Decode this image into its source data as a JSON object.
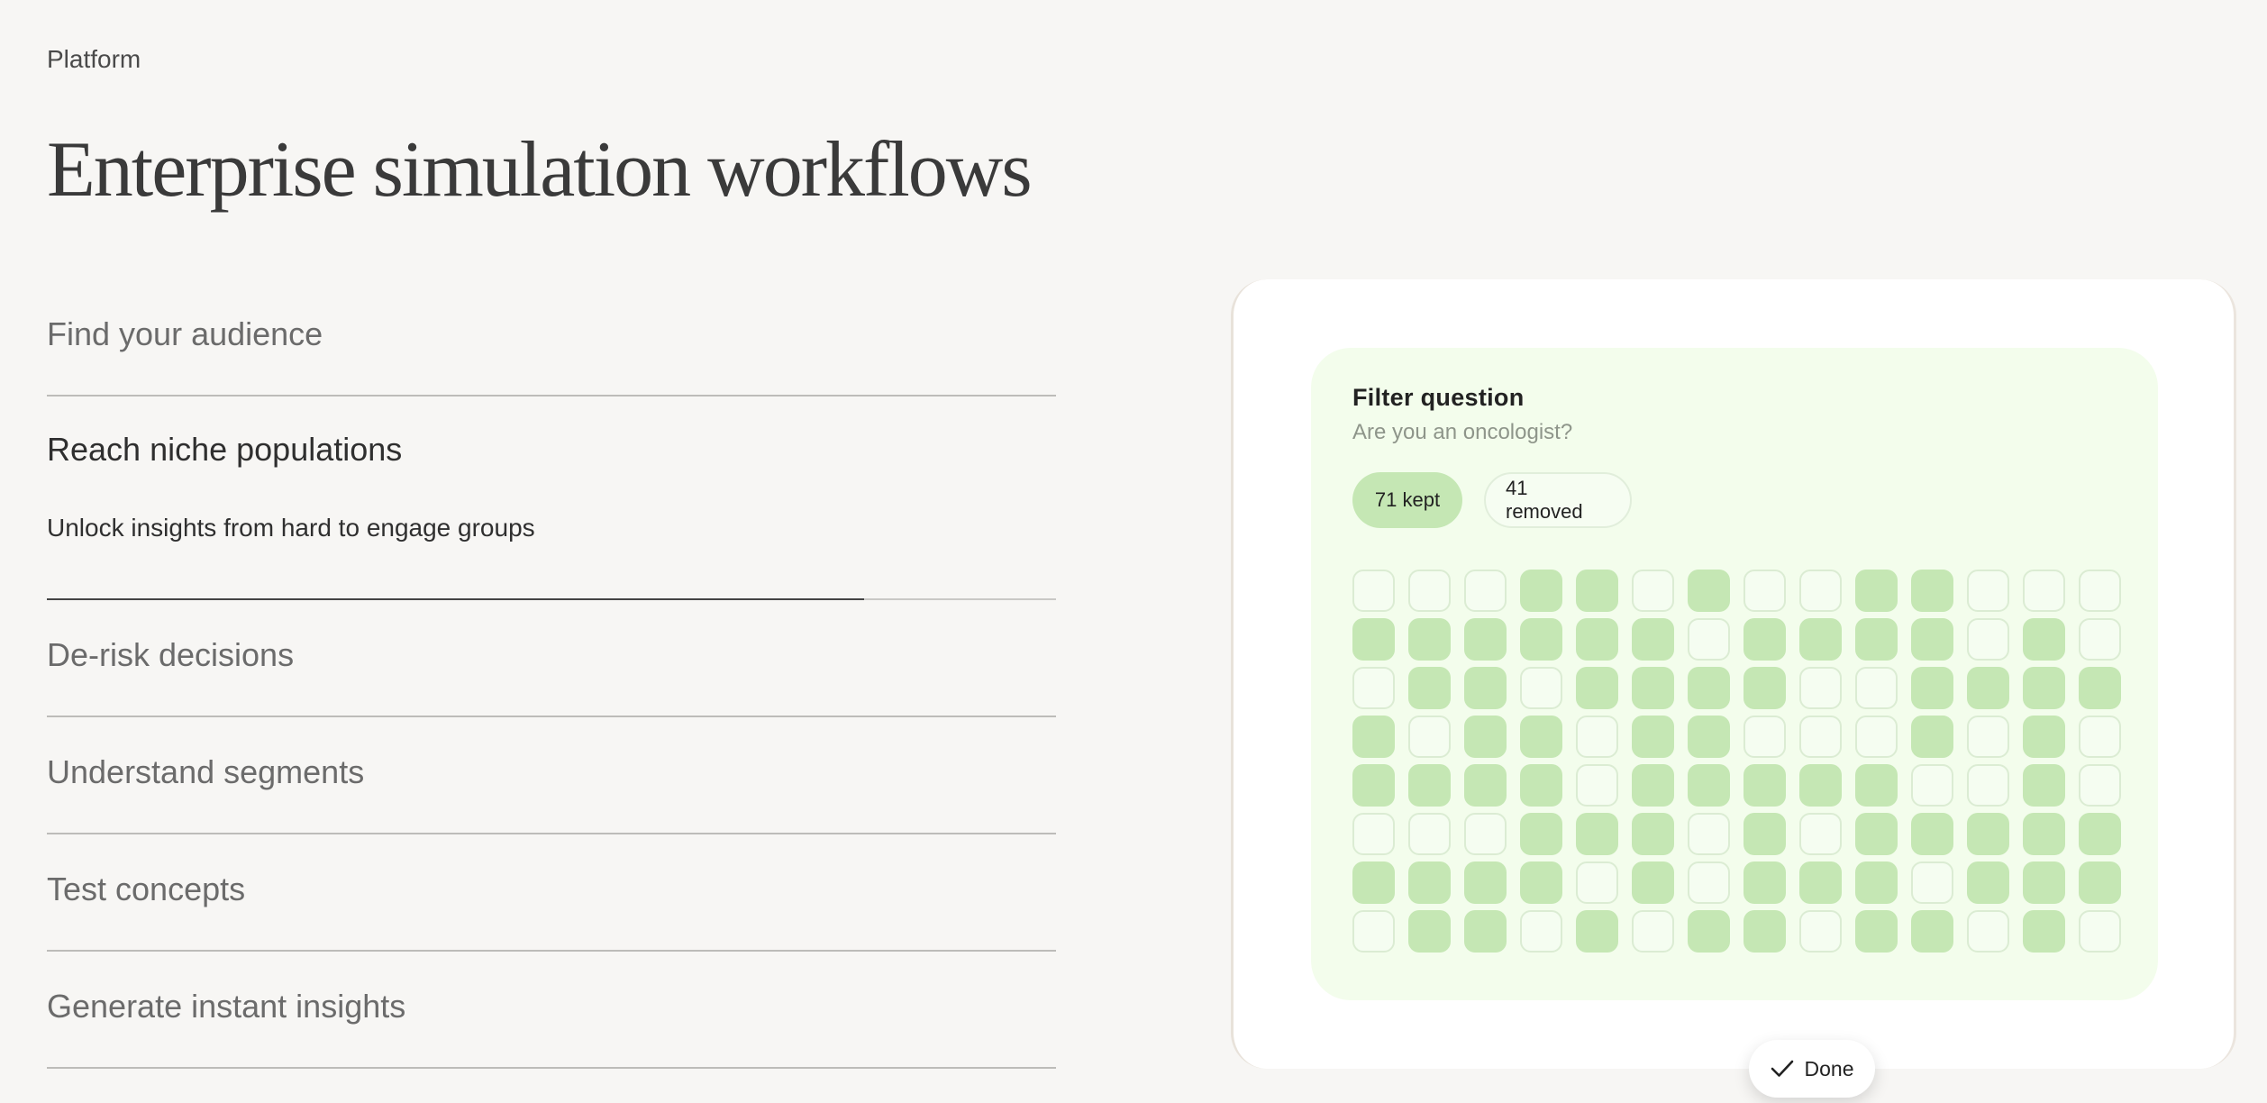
{
  "header": {
    "eyebrow": "Platform",
    "title": "Enterprise simulation workflows"
  },
  "accordion": {
    "items": [
      {
        "label": "Find your audience"
      },
      {
        "label": "Reach niche populations",
        "description": "Unlock insights from hard to engage groups",
        "progress": 0.81
      },
      {
        "label": "De-risk decisions"
      },
      {
        "label": "Understand segments"
      },
      {
        "label": "Test concepts"
      },
      {
        "label": "Generate instant insights"
      }
    ]
  },
  "filter_card": {
    "title": "Filter question",
    "question": "Are you an oncologist?",
    "kept_label": "71 kept",
    "removed_label": "41 removed",
    "done_label": "Done",
    "icons": {
      "done": "check-icon"
    },
    "colors": {
      "kept": "#c5e7b4",
      "removed": "#f5fdf1",
      "panel": "#f3fdec"
    },
    "grid_rows": [
      [
        0,
        0,
        0,
        1,
        1,
        0,
        1,
        0,
        0,
        1,
        1,
        0,
        0,
        0
      ],
      [
        1,
        1,
        1,
        1,
        1,
        1,
        0,
        1,
        1,
        1,
        1,
        0,
        1,
        0
      ],
      [
        0,
        1,
        1,
        0,
        1,
        1,
        1,
        1,
        0,
        0,
        1,
        1,
        1,
        1
      ],
      [
        1,
        0,
        1,
        1,
        0,
        1,
        1,
        0,
        0,
        0,
        1,
        0,
        1,
        0
      ],
      [
        1,
        1,
        1,
        1,
        0,
        1,
        1,
        1,
        1,
        1,
        0,
        0,
        1,
        0
      ],
      [
        0,
        0,
        0,
        1,
        1,
        1,
        0,
        1,
        0,
        1,
        1,
        1,
        1,
        1
      ],
      [
        1,
        1,
        1,
        1,
        0,
        1,
        0,
        1,
        1,
        1,
        0,
        1,
        1,
        1
      ],
      [
        0,
        1,
        1,
        0,
        1,
        0,
        1,
        1,
        0,
        1,
        1,
        0,
        1,
        0
      ]
    ]
  }
}
